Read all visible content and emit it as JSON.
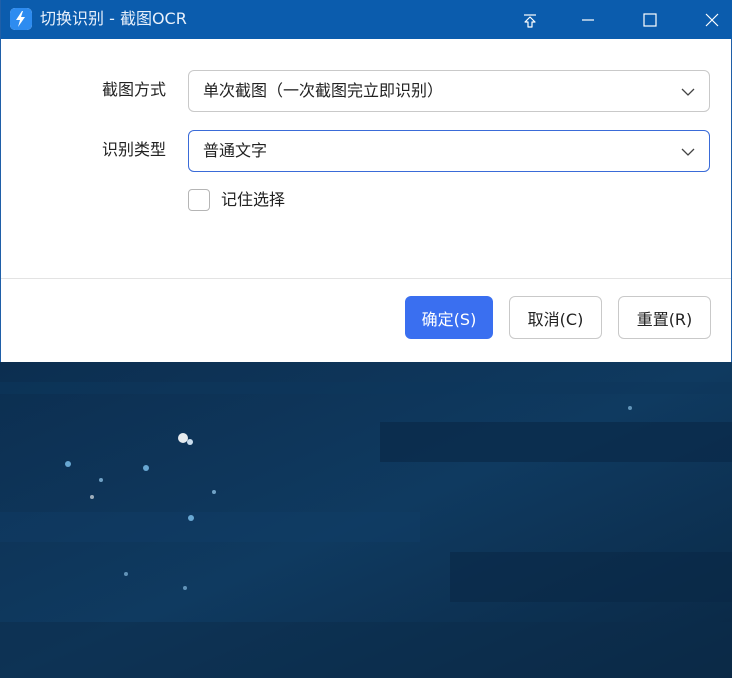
{
  "window": {
    "title": "切换识别 - 截图OCR",
    "controls": {
      "pin_icon": "pin-icon",
      "minimize_icon": "minimize-icon",
      "maximize_icon": "maximize-icon",
      "close_icon": "close-icon"
    }
  },
  "form": {
    "capture_mode": {
      "label": "截图方式",
      "value": "单次截图（一次截图完立即识别）"
    },
    "recognition_type": {
      "label": "识别类型",
      "value": "普通文字"
    },
    "remember_choice": {
      "label": "记住选择",
      "checked": false
    }
  },
  "buttons": {
    "ok": "确定(S)",
    "cancel": "取消(C)",
    "reset": "重置(R)"
  },
  "colors": {
    "titlebar": "#0b5cad",
    "primary_button": "#3a6ff0",
    "focus_border": "#3a6bd8",
    "desktop_background": "#0d3356"
  }
}
